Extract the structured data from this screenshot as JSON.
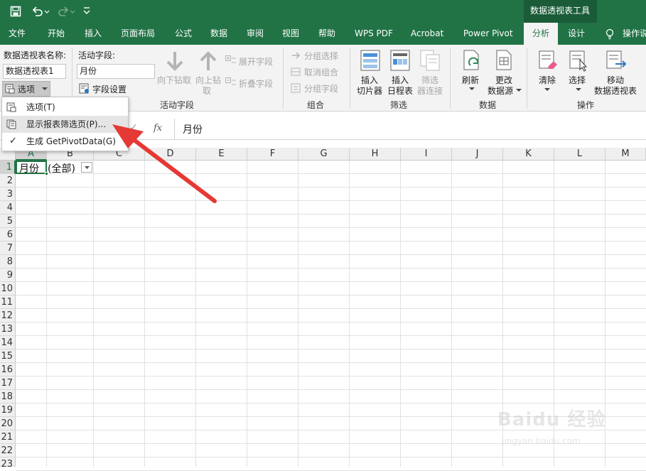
{
  "quick_access": {
    "save_icon": "save-icon",
    "undo_icon": "undo-icon",
    "redo_icon": "redo-icon",
    "customize_icon": "customize-icon"
  },
  "contextual_group": "数据透视表工具",
  "tabs": [
    {
      "label": "文件"
    },
    {
      "label": "开始"
    },
    {
      "label": "插入"
    },
    {
      "label": "页面布局"
    },
    {
      "label": "公式"
    },
    {
      "label": "数据"
    },
    {
      "label": "审阅"
    },
    {
      "label": "视图"
    },
    {
      "label": "帮助"
    },
    {
      "label": "WPS PDF"
    },
    {
      "label": "Acrobat"
    },
    {
      "label": "Power Pivot"
    },
    {
      "label": "分析"
    },
    {
      "label": "设计"
    }
  ],
  "tell_me": "操作说",
  "ribbon": {
    "pivot_name_label": "数据透视表名称:",
    "pivot_name_value": "数据透视表1",
    "options_button": "选项",
    "active_field_label": "活动字段:",
    "active_field_value": "月份",
    "field_settings": "字段设置",
    "drill_down": "向下钻取",
    "drill_up_1": "向上钻",
    "drill_up_2": "取",
    "expand_field": "展开字段",
    "collapse_field": "折叠字段",
    "group_active_field": "活动字段",
    "group_selection": "分组选择",
    "ungroup": "取消组合",
    "group_field": "分组字段",
    "group_group": "组合",
    "insert_slicer_1": "插入",
    "insert_slicer_2": "切片器",
    "insert_timeline_1": "插入",
    "insert_timeline_2": "日程表",
    "filter_conn_1": "筛选",
    "filter_conn_2": "器连接",
    "group_filter": "筛选",
    "refresh": "刷新",
    "change_source_1": "更改",
    "change_source_2": "数据源",
    "group_data": "数据",
    "clear": "清除",
    "select": "选择",
    "move_1": "移动",
    "move_2": "数据透视表",
    "group_actions": "操作"
  },
  "options_menu": [
    {
      "label": "选项(T)",
      "checked": false
    },
    {
      "label": "显示报表筛选页(P)...",
      "checked": false
    },
    {
      "label": "生成 GetPivotData(G)",
      "checked": true
    }
  ],
  "formula_bar": {
    "fx": "fx",
    "value": "月份"
  },
  "columns": [
    "A",
    "B",
    "C",
    "D",
    "E",
    "F",
    "G",
    "H",
    "I",
    "J",
    "K",
    "L",
    "M"
  ],
  "rows": [
    "1",
    "2",
    "3",
    "4",
    "5",
    "6",
    "7",
    "8",
    "9",
    "10",
    "11",
    "12",
    "13",
    "14",
    "15",
    "16",
    "17",
    "18",
    "19",
    "20",
    "21",
    "22",
    "23"
  ],
  "cells": {
    "A1": "月份",
    "B1": "(全部)"
  },
  "watermark": {
    "brand": "Baidu 经验",
    "url": "jingyan.baidu.com"
  },
  "colors": {
    "excel_green": "#217346",
    "ribbon_bg": "#f3f3f3",
    "arrow_red": "#e53935"
  }
}
